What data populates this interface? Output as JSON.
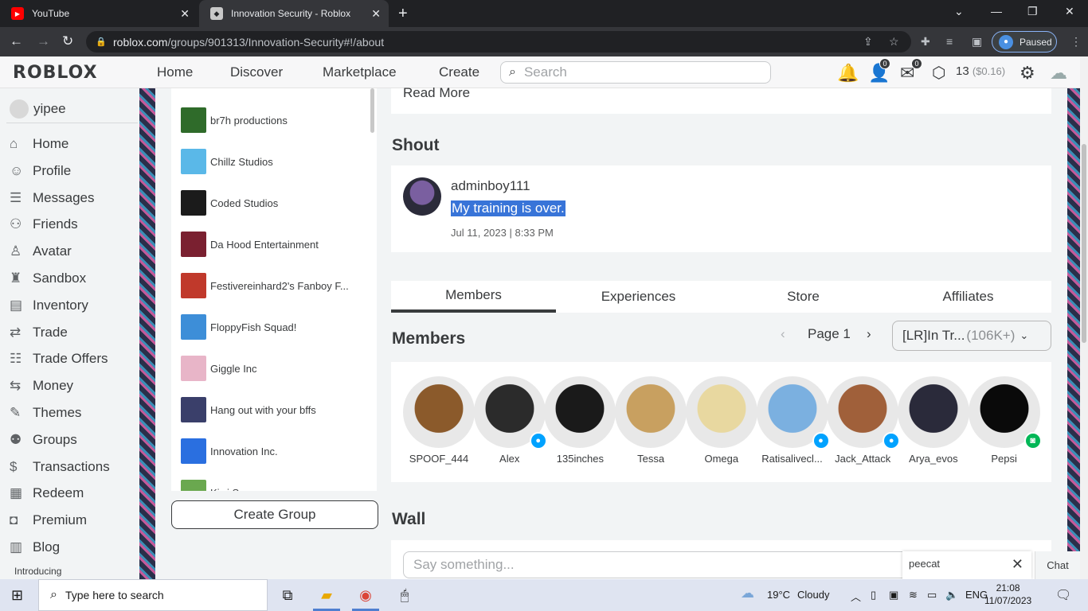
{
  "browser": {
    "tabs": [
      {
        "title": "YouTube",
        "icon": "youtube-icon"
      },
      {
        "title": "Innovation Security - Roblox",
        "icon": "roblox-icon"
      }
    ],
    "url_host": "roblox.com",
    "url_path": "/groups/901313/Innovation-Security#!/about",
    "profile_status": "Paused"
  },
  "topnav": {
    "logo": "ROBLOX",
    "links": [
      "Home",
      "Discover",
      "Marketplace",
      "Create"
    ],
    "search_placeholder": "Search",
    "friends_badge": "0",
    "messages_badge": "0",
    "robux_amount": "13",
    "robux_value": "($0.16)"
  },
  "sidebar": {
    "username": "yipee",
    "items": [
      {
        "label": "Home",
        "icon": "home-icon"
      },
      {
        "label": "Profile",
        "icon": "profile-icon"
      },
      {
        "label": "Messages",
        "icon": "messages-icon"
      },
      {
        "label": "Friends",
        "icon": "friends-icon"
      },
      {
        "label": "Avatar",
        "icon": "avatar-icon"
      },
      {
        "label": "Sandbox",
        "icon": "sandbox-icon"
      },
      {
        "label": "Inventory",
        "icon": "inventory-icon"
      },
      {
        "label": "Trade",
        "icon": "trade-icon"
      },
      {
        "label": "Trade Offers",
        "icon": "trade-offers-icon"
      },
      {
        "label": "Money",
        "icon": "money-icon"
      },
      {
        "label": "Themes",
        "icon": "themes-icon"
      },
      {
        "label": "Groups",
        "icon": "groups-icon"
      },
      {
        "label": "Transactions",
        "icon": "transactions-icon"
      },
      {
        "label": "Redeem",
        "icon": "redeem-icon"
      },
      {
        "label": "Premium",
        "icon": "premium-icon"
      },
      {
        "label": "Blog",
        "icon": "blog-icon"
      }
    ],
    "footer_text": "Introducing"
  },
  "groups": {
    "items": [
      {
        "name": "br7h productions",
        "color": "#2f6b2a"
      },
      {
        "name": "Chillz Studios",
        "color": "#5ab8e8"
      },
      {
        "name": "Coded Studios",
        "color": "#1b1b1b"
      },
      {
        "name": "Da Hood Entertainment",
        "color": "#7a2030"
      },
      {
        "name": "Festivereinhard2's Fanboy F...",
        "color": "#c0392b"
      },
      {
        "name": "FloppyFish Squad!",
        "color": "#3d8ed8"
      },
      {
        "name": "Giggle Inc",
        "color": "#e8b5c8"
      },
      {
        "name": "Hang out with your bffs",
        "color": "#3a3f6a"
      },
      {
        "name": "Innovation Inc.",
        "color": "#2a6fe0"
      },
      {
        "name": "Kiwi S...",
        "color": "#6aa84f"
      }
    ],
    "create_button": "Create Group"
  },
  "main": {
    "read_more": "Read More",
    "shout_title": "Shout",
    "shout": {
      "username": "adminboy111",
      "message": "My training is over.",
      "date": "Jul 11, 2023 | 8:33 PM"
    },
    "tabs": [
      "Members",
      "Experiences",
      "Store",
      "Affiliates"
    ],
    "members_title": "Members",
    "page_label": "Page 1",
    "role_select": "[LR]In Tr...",
    "role_count": "(106K+)",
    "members": [
      {
        "name": "SPOOF_444",
        "status": "",
        "color": "#8b5a2b"
      },
      {
        "name": "Alex",
        "status": "online",
        "color": "#2b2b2b"
      },
      {
        "name": "135inches",
        "status": "",
        "color": "#1a1a1a"
      },
      {
        "name": "Tessa",
        "status": "",
        "color": "#c8a060"
      },
      {
        "name": "Omega",
        "status": "",
        "color": "#e8d8a0"
      },
      {
        "name": "Ratisalivecl...",
        "status": "online",
        "color": "#7bb0e0"
      },
      {
        "name": "Jack_Attack",
        "status": "online",
        "color": "#a0603a"
      },
      {
        "name": "Arya_evos",
        "status": "",
        "color": "#2a2a3a"
      },
      {
        "name": "Pepsi",
        "status": "in-game",
        "color": "#0a0a0a"
      }
    ],
    "wall_title": "Wall",
    "wall_placeholder": "Say something...",
    "chat_popup_user": "peecat",
    "chat_label": "Chat"
  },
  "taskbar": {
    "search_placeholder": "Type here to search",
    "weather_temp": "19°C",
    "weather_desc": "Cloudy",
    "lang": "ENG",
    "time": "21:08",
    "date": "11/07/2023"
  }
}
